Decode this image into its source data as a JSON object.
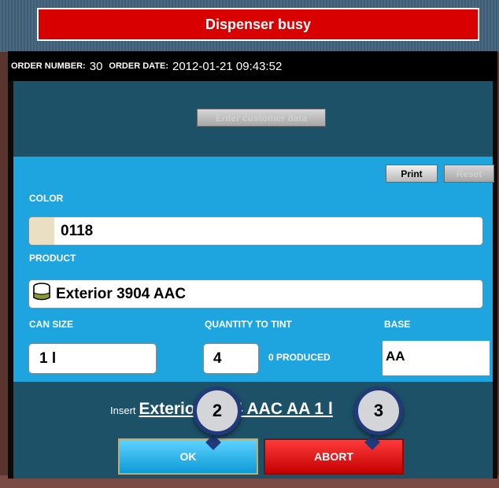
{
  "window": {
    "title": "Dispenser busy"
  },
  "order": {
    "number_label": "ORDER NUMBER:",
    "number": "30",
    "date_label": "ORDER DATE:",
    "date": "2012-01-21 09:43:52"
  },
  "customer": {
    "button_label": "Enter customer data"
  },
  "actions": {
    "print_label": "Print",
    "reset_label": "Reset"
  },
  "color": {
    "label": "COLOR",
    "value": "0118",
    "swatch": "#eadfc2"
  },
  "product": {
    "label": "PRODUCT",
    "value": "Exterior 3904 AAC",
    "icon": "can-icon"
  },
  "can_size": {
    "label": "CAN SIZE",
    "value": "1 l"
  },
  "quantity": {
    "label": "QUANTITY TO TINT",
    "value": "4",
    "produced": "0 PRODUCED"
  },
  "base": {
    "label": "BASE",
    "value": "AA"
  },
  "instruction": {
    "prefix": "Insert",
    "text": "Exterior 3904 AAC AA 1 l"
  },
  "buttons": {
    "ok": "OK",
    "abort": "ABORT"
  },
  "badges": [
    "2",
    "3"
  ]
}
